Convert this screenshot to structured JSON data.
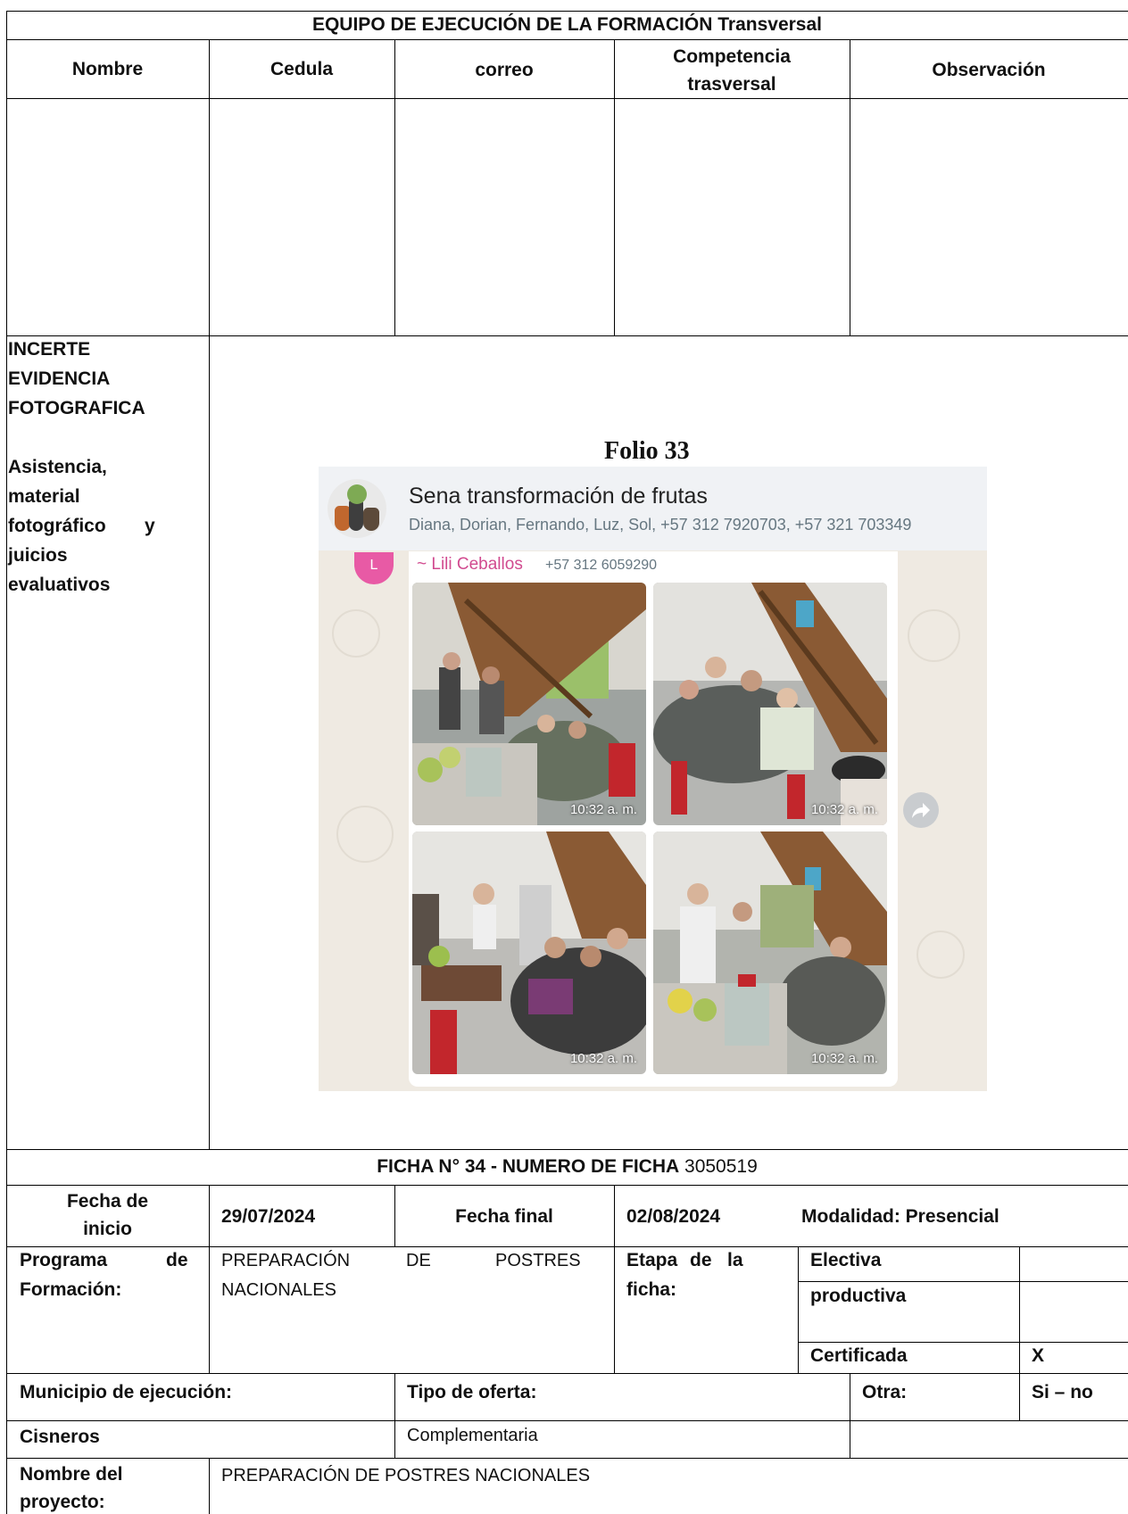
{
  "team_section": {
    "title_bold": "EQUIPO DE EJECUCIÓN DE LA FORMACIÓN",
    "title_suffix": "Transversal",
    "col_nombre": "Nombre",
    "col_cedula": "Cedula",
    "col_correo": "correo",
    "col_competencia_1": "Competencia",
    "col_competencia_2": "trasversal",
    "col_observacion": "Observación"
  },
  "evidence_section": {
    "label_lines": [
      "INCERTE",
      "EVIDENCIA",
      "FOTOGRAFICA"
    ],
    "sub_lines": [
      "Asistencia,",
      "material",
      "fotográfico",
      "y",
      "juicios",
      "evaluativos"
    ],
    "folio": "Folio 33",
    "chat": {
      "group_name": "Sena transformación de frutas",
      "members": "Diana, Dorian, Fernando, Luz, Sol, +57 312 7920703, +57 321 703349",
      "sender_initial": "L",
      "sender_name": "~ Lili Ceballos",
      "sender_phone": "+57 312 6059290",
      "photo_times": [
        "10:32 a. m.",
        "10:32 a. m.",
        "10:32 a. m.",
        "10:32 a. m."
      ],
      "icons": [
        "avatar-icon",
        "forward-icon"
      ]
    }
  },
  "ficha": {
    "title_bold": "FICHA N° 34 - NUMERO DE FICHA",
    "number": "3050519",
    "fecha_inicio_1": "Fecha de",
    "fecha_inicio_2": "inicio",
    "fecha_inicio_value": "29/07/2024",
    "fecha_final_label": "Fecha final",
    "fecha_final_value": "02/08/2024",
    "modalidad": "Modalidad: Presencial",
    "programa_1": "Programa",
    "programa_de": "de",
    "programa_2": "Formación:",
    "programa_value_1a": "PREPARACIÓN",
    "programa_value_1b": "DE",
    "programa_value_1c": "POSTRES",
    "programa_value_2": "NACIONALES",
    "etapa_1a": "Etapa",
    "etapa_1b": "de",
    "etapa_1c": "la",
    "etapa_2": "ficha:",
    "electiva": "Electiva",
    "productiva": "productiva",
    "certificada": "Certificada",
    "certificada_mark": "X",
    "municipio_label": "Municipio de ejecución:",
    "tipo_oferta_label": "Tipo de oferta:",
    "otra_label": "Otra:",
    "si_no": "Si – no",
    "municipio_value": "Cisneros",
    "tipo_oferta_value": "Complementaria",
    "proyecto_1": "Nombre del",
    "proyecto_2": "proyecto:",
    "proyecto_value": "PREPARACIÓN DE POSTRES NACIONALES"
  }
}
